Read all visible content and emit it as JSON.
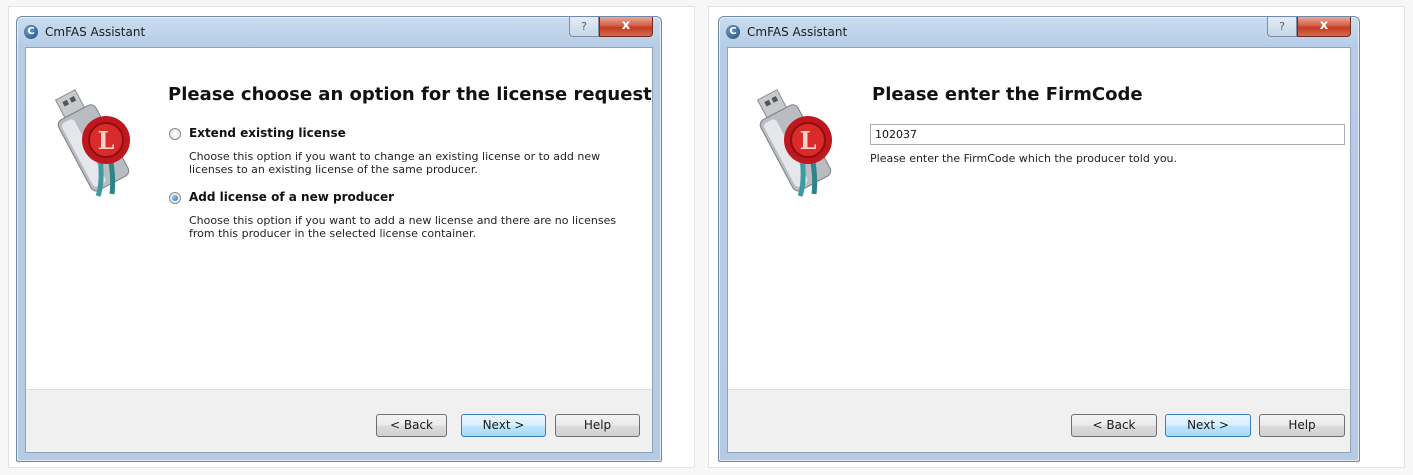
{
  "left_dialog": {
    "title": "CmFAS Assistant",
    "help_glyph": "?",
    "close_glyph": "x",
    "heading": "Please choose an option for the license request",
    "options": [
      {
        "label": "Extend existing license",
        "desc_line1": "Choose this option if you want to change an existing license or to add new",
        "desc_line2": "licenses to an existing license of the same producer.",
        "selected": false
      },
      {
        "label": "Add license of a new producer",
        "desc_line1": "Choose this option if you want to add a new license and there are no licenses",
        "desc_line2": "from this producer in the selected license container.",
        "selected": true
      }
    ],
    "buttons": {
      "back": "< Back",
      "next": "Next >",
      "help": "Help"
    }
  },
  "right_dialog": {
    "title": "CmFAS Assistant",
    "help_glyph": "?",
    "close_glyph": "x",
    "heading": "Please enter the FirmCode",
    "firmcode_value": "102037",
    "hint": "Please enter the FirmCode which the producer told you.",
    "buttons": {
      "back": "< Back",
      "next": "Next >",
      "help": "Help"
    }
  },
  "icons": {
    "app": "cmfas-app-icon",
    "logo": "usb-license-seal-icon"
  },
  "colors": {
    "close_button": "#c23b22",
    "default_button_border": "#3c7fb1",
    "title_gradient": "#c9dcef"
  }
}
